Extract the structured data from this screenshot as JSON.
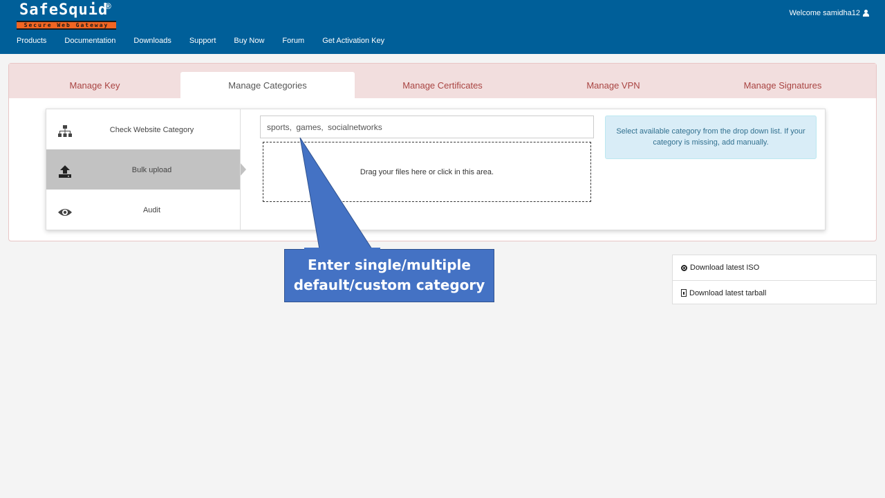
{
  "header": {
    "logo_text": "SafeSquid",
    "logo_reg": "®",
    "logo_tagline": "Secure Web Gateway",
    "welcome": "Welcome samidha12",
    "nav": [
      "Products",
      "Documentation",
      "Downloads",
      "Support",
      "Buy Now",
      "Forum",
      "Get Activation Key"
    ]
  },
  "tabs": [
    "Manage Key",
    "Manage Categories",
    "Manage Certificates",
    "Manage VPN",
    "Manage Signatures"
  ],
  "active_tab": "Manage Categories",
  "sidebar": [
    {
      "label": "Check Website Category",
      "icon": "sitemap-icon"
    },
    {
      "label": "Bulk upload",
      "icon": "upload-icon"
    },
    {
      "label": "Audit",
      "icon": "eye-icon"
    }
  ],
  "active_sidebar": "Bulk upload",
  "category_input": {
    "value": "sports,  games,  socialnetworks"
  },
  "dropzone_text": "Drag your files here or click in this area.",
  "info_text": "Select available category from the drop down list. If your category is missing, add manually.",
  "downloads": [
    {
      "label": "Download latest ISO",
      "icon": "disc-icon"
    },
    {
      "label": "Download latest tarball",
      "icon": "file-archive-icon"
    }
  ],
  "callout": {
    "line1": "Enter single/multiple",
    "line2": "default/custom category"
  },
  "colors": {
    "header_bg": "#005f99",
    "tab_bar_bg": "#f2dede",
    "tab_text": "#a94442",
    "callout_fill": "#4472c4",
    "info_bg": "#d9edf7"
  }
}
